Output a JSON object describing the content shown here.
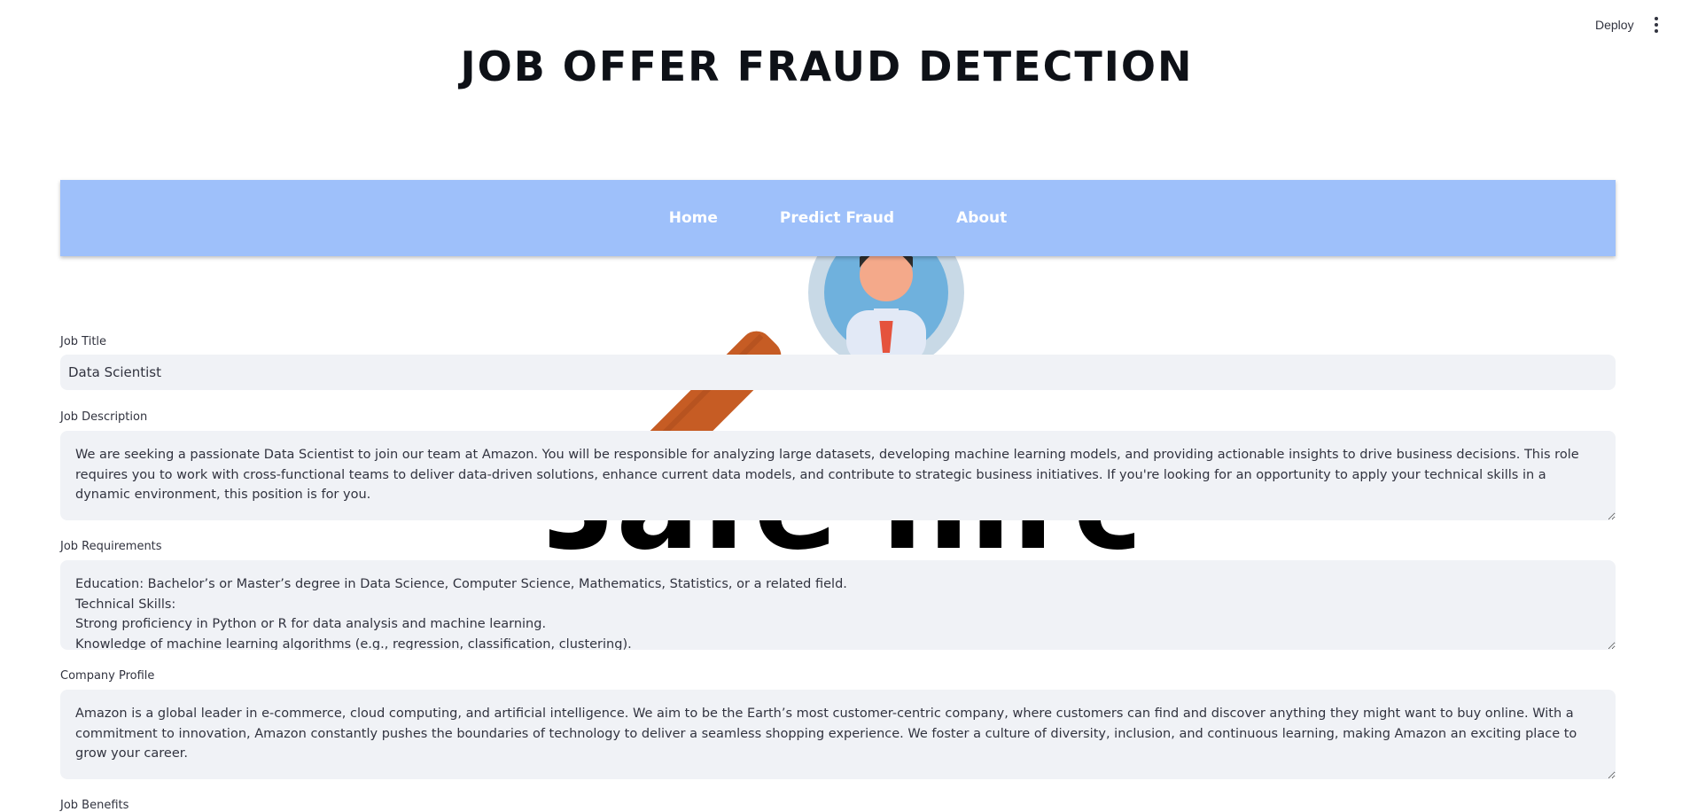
{
  "header": {
    "deploy_label": "Deploy",
    "menu_icon": "vertical-ellipsis-icon"
  },
  "page_title": "JOB OFFER FRAUD DETECTION",
  "nav": {
    "items": [
      {
        "label": "Home"
      },
      {
        "label": "Predict Fraud"
      },
      {
        "label": "About"
      }
    ]
  },
  "logo": {
    "text": "Safe hire",
    "icon": "magnifier-person-icon"
  },
  "form": {
    "job_title": {
      "label": "Job Title",
      "value": "Data Scientist"
    },
    "job_description": {
      "label": "Job Description",
      "value": "We are seeking a passionate Data Scientist to join our team at Amazon. You will be responsible for analyzing large datasets, developing machine learning models, and providing actionable insights to drive business decisions. This role requires you to work with cross-functional teams to deliver data-driven solutions, enhance current data models, and contribute to strategic business initiatives. If you're looking for an opportunity to apply your technical skills in a dynamic environment, this position is for you."
    },
    "job_requirements": {
      "label": "Job Requirements",
      "value": "Education: Bachelor’s or Master’s degree in Data Science, Computer Science, Mathematics, Statistics, or a related field.\nTechnical Skills:\nStrong proficiency in Python or R for data analysis and machine learning.\nKnowledge of machine learning algorithms (e.g., regression, classification, clustering)."
    },
    "company_profile": {
      "label": "Company Profile",
      "value": "Amazon is a global leader in e-commerce, cloud computing, and artificial intelligence. We aim to be the Earth’s most customer-centric company, where customers can find and discover anything they might want to buy online. With a commitment to innovation, Amazon constantly pushes the boundaries of technology to deliver a seamless shopping experience. We foster a culture of diversity, inclusion, and continuous learning, making Amazon an exciting place to grow your career."
    },
    "job_benefits": {
      "label": "Job Benefits"
    }
  },
  "colors": {
    "nav_bg": "#9ec0fa",
    "input_bg": "#f0f2f6",
    "text": "#31333f"
  }
}
